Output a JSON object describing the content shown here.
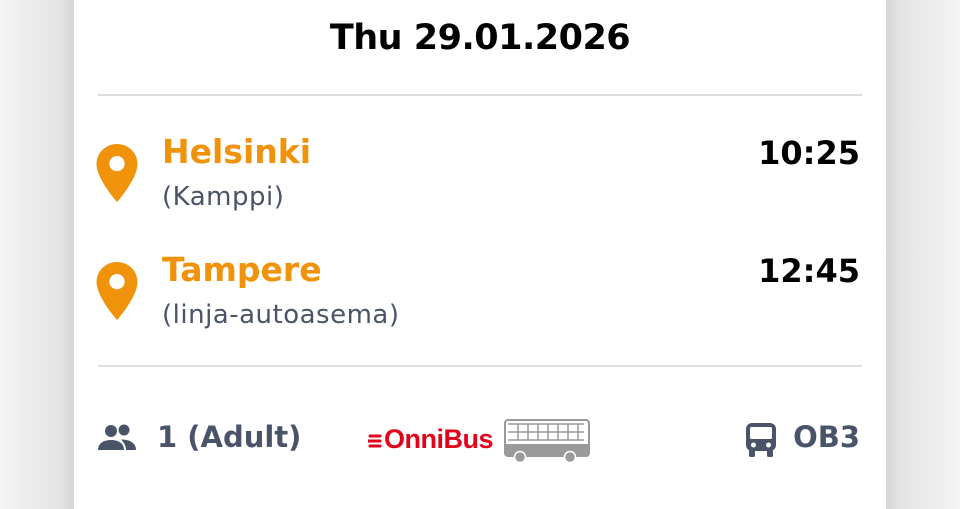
{
  "trip": {
    "date": "Thu 29.01.2026",
    "origin": {
      "city": "Helsinki",
      "station": "(Kamppi)",
      "time": "10:25"
    },
    "destination": {
      "city": "Tampere",
      "station": "(linja-autoasema)",
      "time": "12:45"
    }
  },
  "footer": {
    "passengers": "1 (Adult)",
    "operator": "OnniBus",
    "route": "OB3"
  },
  "colors": {
    "accent": "#f0920a",
    "brand": "#e3001b",
    "muted": "#4a5468"
  },
  "icons": {
    "pin": "location-pin-icon",
    "passengers": "people-icon",
    "bus": "bus-icon"
  }
}
